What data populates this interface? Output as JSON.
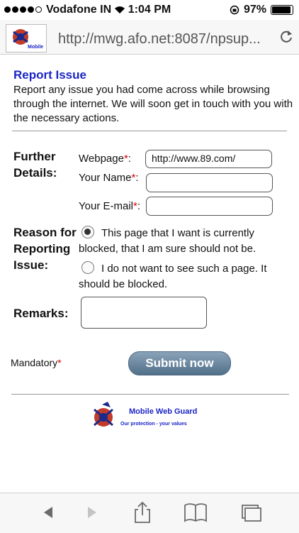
{
  "status_bar": {
    "carrier": "Vodafone IN",
    "time": "1:04 PM",
    "battery": "97%",
    "signal_bars": 4
  },
  "browser": {
    "url": "http://mwg.afo.net:8087/npsup...",
    "favicon_label": "Mobile"
  },
  "report": {
    "title": "Report Issue",
    "intro": "Report any issue you had come across while browsing through the internet. We will soon get in touch with you with the necessary actions.",
    "further_details_label": "Further Details:",
    "webpage_label": "Webpage",
    "webpage_value": "http://www.89.com/",
    "name_label": "Your Name",
    "name_value": "",
    "email_label": "Your E-mail",
    "email_value": "",
    "required_mark": "*",
    "colon": ":",
    "reason_label": "Reason for Reporting Issue:",
    "reason_options": [
      {
        "label": "This page that I want is currently blocked, that I am sure should not be.",
        "selected": true
      },
      {
        "label": "I do not want to see such a page. It should be blocked.",
        "selected": false
      }
    ],
    "remarks_label": "Remarks:",
    "mandatory_label": "Mandatory",
    "submit_label": "Submit now"
  },
  "footer": {
    "brand": "Mobile Web Guard",
    "tagline": "Our protection - your values"
  },
  "colors": {
    "title_blue": "#1b25c6",
    "required_red": "#dd0000",
    "submit_button": "#5f7c96"
  }
}
